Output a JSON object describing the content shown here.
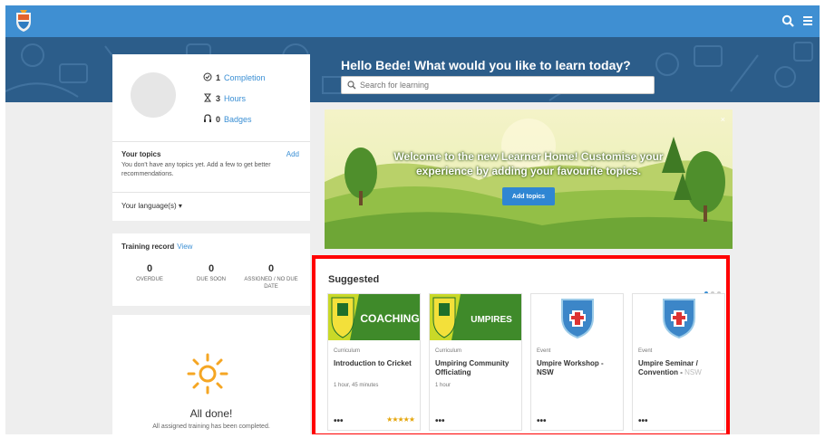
{
  "colors": {
    "topbar": "#3f8fd2",
    "banner": "#2c5d8a",
    "link": "#3a8fd4",
    "accent_button": "#2f86d3",
    "highlight_border": "#ff0000",
    "stars": "#e5a60c"
  },
  "header": {
    "greeting": "Hello Bede! What would you like to learn today?",
    "search_placeholder": "Search for learning",
    "icons": [
      "search-icon",
      "menu-icon",
      "logo"
    ]
  },
  "profile": {
    "stats": [
      {
        "icon": "clock-check-icon",
        "value": "1",
        "label": "Completion"
      },
      {
        "icon": "hourglass-icon",
        "value": "3",
        "label": "Hours"
      },
      {
        "icon": "badge-icon",
        "value": "0",
        "label": "Badges"
      }
    ],
    "topics_title": "Your topics",
    "topics_add": "Add",
    "topics_text": "You don't have any topics yet. Add a few to get better recommendations.",
    "language_label": "Your language(s)"
  },
  "training": {
    "title": "Training record",
    "view_link": "View",
    "columns": [
      {
        "value": "0",
        "label": "OVERDUE"
      },
      {
        "value": "0",
        "label": "DUE SOON"
      },
      {
        "value": "0",
        "label": "ASSIGNED / NO DUE DATE"
      }
    ]
  },
  "done": {
    "title": "All done!",
    "text": "All assigned training has been completed."
  },
  "hero": {
    "line1": "Welcome to the new Learner Home! Customise your",
    "line2": "experience by adding your favourite topics.",
    "button": "Add topics",
    "close": "×"
  },
  "suggested": {
    "title": "Suggested",
    "carousel_dots": 3,
    "active_dot": 0,
    "cards": [
      {
        "type": "Curriculum",
        "title": "Introduction to Cricket",
        "duration": "1 hour, 45 minutes",
        "thumb_label": "COACHING",
        "rating": 5,
        "stars": "★★★★★"
      },
      {
        "type": "Curriculum",
        "title": "Umpiring Community Officiating",
        "duration": "1 hour",
        "thumb_label": "UMPIRES"
      },
      {
        "type": "Event",
        "title": "Umpire Workshop - NSW",
        "duration": ""
      },
      {
        "type": "Event",
        "title": "Umpire Seminar / Convention - ",
        "title_faded": "NSW",
        "duration": ""
      }
    ],
    "more_label": "•••"
  }
}
